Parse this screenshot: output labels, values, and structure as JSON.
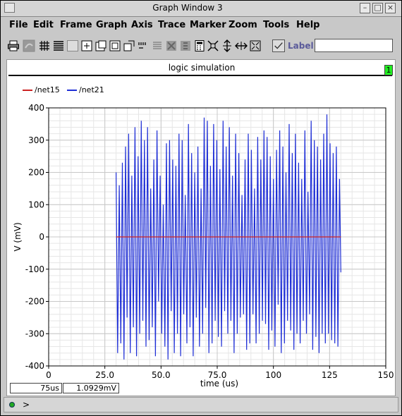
{
  "window": {
    "title": "Graph Window 3"
  },
  "menu": [
    "File",
    "Edit",
    "Frame",
    "Graph",
    "Axis",
    "Trace",
    "Marker",
    "Zoom",
    "Tools",
    "Help"
  ],
  "toolbar": {
    "icons": [
      "print-icon",
      "undo-icon",
      "grid-icon",
      "strip-icon",
      "box-icon",
      "zoom-fit-icon",
      "zoom-in-icon",
      "zoom-out-icon",
      "zoom-region-icon",
      "marker-icon",
      "eye-icon",
      "cut-icon",
      "paste-icon",
      "calculator-icon",
      "fit-icon",
      "vertical-fit-icon",
      "horizontal-fit-icon",
      "fullscreen-icon"
    ],
    "label_text": "Label",
    "label_value": ""
  },
  "graph": {
    "title": "logic simulation",
    "badge": "1",
    "legend": [
      {
        "name": "/net15",
        "color": "#cc2222"
      },
      {
        "name": "/net21",
        "color": "#1e2ed6"
      }
    ]
  },
  "readouts": {
    "x": "75us",
    "y": "1.0929mV"
  },
  "cmdline": {
    "prompt": ">"
  },
  "chart_data": {
    "type": "line",
    "xlabel": "time (us)",
    "ylabel": "V (mV)",
    "xlim": [
      0,
      150
    ],
    "ylim": [
      -400,
      400
    ],
    "xticks": [
      "0",
      "25.0",
      "50.0",
      "75.0",
      "100",
      "125",
      "150"
    ],
    "yticks": [
      "400",
      "300",
      "200",
      "100",
      "0",
      "-100",
      "-200",
      "-300",
      "-400"
    ],
    "grid": true,
    "legend_position": "top-left",
    "series": [
      {
        "name": "/net15",
        "color": "#cc2222",
        "x": [
          30,
          130
        ],
        "y": [
          0,
          0
        ]
      },
      {
        "name": "/net21",
        "color": "#1e2ed6",
        "x": [
          30,
          30.7,
          31.4,
          32.1,
          32.8,
          33.5,
          34.2,
          34.9,
          35.6,
          36.3,
          37,
          37.7,
          38.4,
          39.1,
          39.8,
          40.5,
          41.2,
          41.9,
          42.6,
          43.3,
          44,
          44.7,
          45.4,
          46.1,
          46.8,
          47.5,
          48.2,
          48.9,
          49.6,
          50.3,
          51,
          51.7,
          52.4,
          53.1,
          53.8,
          54.5,
          55.2,
          55.9,
          56.6,
          57.3,
          58,
          58.7,
          59.4,
          60.1,
          60.8,
          61.5,
          62.2,
          62.9,
          63.6,
          64.3,
          65,
          65.7,
          66.4,
          67.1,
          67.8,
          68.5,
          69.2,
          69.9,
          70.6,
          71.3,
          72,
          72.7,
          73.4,
          74.1,
          74.8,
          75.5,
          76.2,
          76.9,
          77.6,
          78.3,
          79,
          79.7,
          80.4,
          81.1,
          81.8,
          82.5,
          83.2,
          83.9,
          84.6,
          85.3,
          86,
          86.7,
          87.4,
          88.1,
          88.8,
          89.5,
          90.2,
          90.9,
          91.6,
          92.3,
          93,
          93.7,
          94.4,
          95.1,
          95.8,
          96.5,
          97.2,
          97.9,
          98.6,
          99.3,
          100,
          100.7,
          101.4,
          102.1,
          102.8,
          103.5,
          104.2,
          104.9,
          105.6,
          106.3,
          107,
          107.7,
          108.4,
          109.1,
          109.8,
          110.5,
          111.2,
          111.9,
          112.6,
          113.3,
          114,
          114.7,
          115.4,
          116.1,
          116.8,
          117.5,
          118.2,
          118.9,
          119.6,
          120.3,
          121,
          121.7,
          122.4,
          123.1,
          123.8,
          124.5,
          125.2,
          125.9,
          126.6,
          127.3,
          128,
          128.7,
          129.4,
          130
        ],
        "y": [
          200,
          -360,
          160,
          -330,
          230,
          -380,
          280,
          -250,
          320,
          -360,
          190,
          -280,
          340,
          -370,
          250,
          -300,
          360,
          -260,
          300,
          -340,
          340,
          -320,
          150,
          -280,
          240,
          -370,
          330,
          -200,
          190,
          -300,
          100,
          -340,
          290,
          -380,
          300,
          -230,
          240,
          -360,
          220,
          -300,
          320,
          -370,
          300,
          -240,
          130,
          -330,
          350,
          -280,
          260,
          -370,
          200,
          -250,
          280,
          -340,
          150,
          -300,
          370,
          -220,
          360,
          -360,
          220,
          -330,
          350,
          -260,
          300,
          -310,
          210,
          -340,
          360,
          -230,
          280,
          -300,
          340,
          -260,
          190,
          -360,
          320,
          -300,
          260,
          -250,
          130,
          -240,
          240,
          -350,
          320,
          -330,
          270,
          -240,
          150,
          -330,
          310,
          -300,
          240,
          -260,
          330,
          -270,
          310,
          -350,
          250,
          -290,
          180,
          -340,
          270,
          -210,
          330,
          -360,
          280,
          -330,
          200,
          -260,
          350,
          -290,
          260,
          -350,
          320,
          -300,
          230,
          -330,
          180,
          -260,
          330,
          -300,
          140,
          -240,
          360,
          -350,
          300,
          -310,
          280,
          -360,
          240,
          -300,
          320,
          -330,
          380,
          -300,
          290,
          -320,
          260,
          -330,
          280,
          -340,
          180,
          -110
        ]
      }
    ]
  }
}
